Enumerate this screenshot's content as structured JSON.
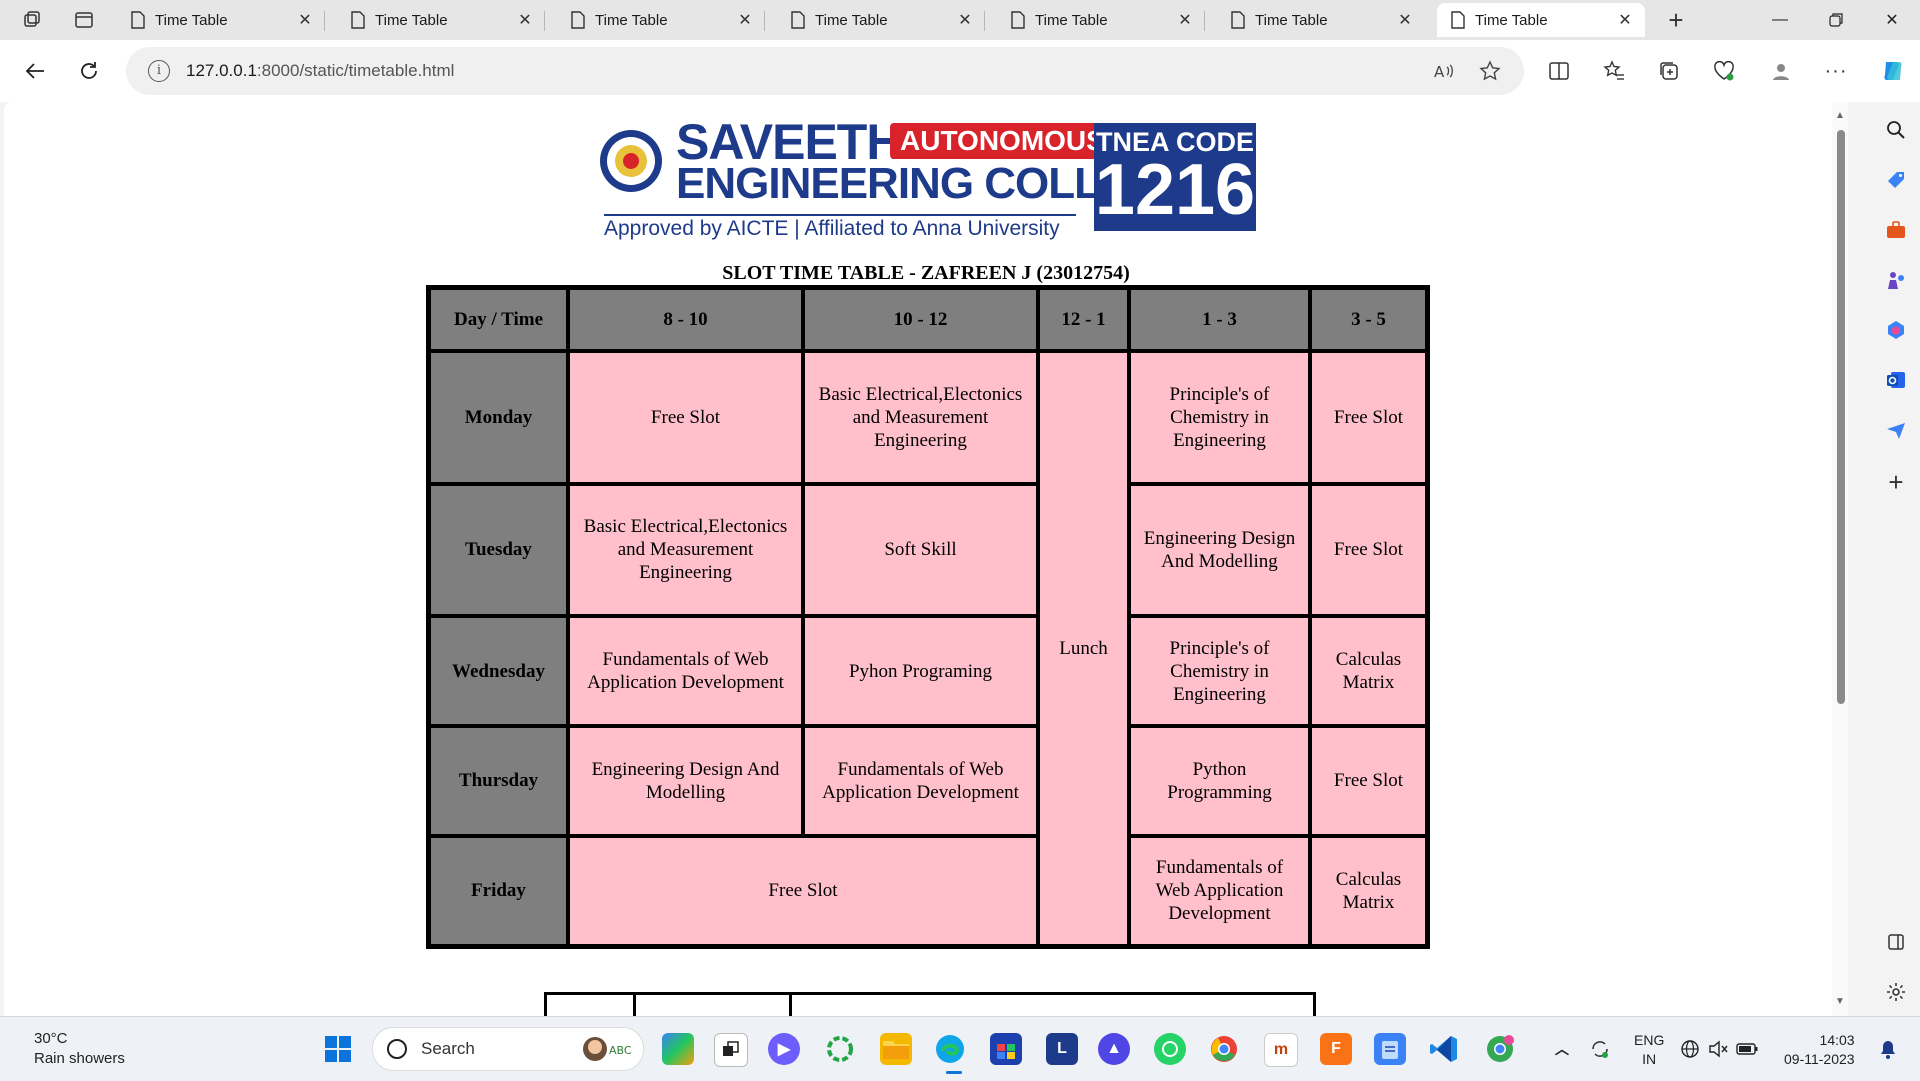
{
  "browser": {
    "tabs": [
      {
        "title": "Time Table"
      },
      {
        "title": "Time Table"
      },
      {
        "title": "Time Table"
      },
      {
        "title": "Time Table"
      },
      {
        "title": "Time Table"
      },
      {
        "title": "Time Table"
      },
      {
        "title": "Time Table",
        "active": true
      }
    ],
    "url_host": "127.0.0.1",
    "url_path": ":8000/static/timetable.html"
  },
  "logo": {
    "name_line1": "SAVEETHA",
    "badge": "AUTONOMOUS",
    "name_line2": "ENGINEERING COLLEGE",
    "affiliation": "Approved by AICTE  |  Affiliated to Anna University",
    "tnea_label": "TNEA CODE",
    "tnea_code": "1216",
    "brand_blue": "#1e3a8a",
    "brand_red": "#d8232a"
  },
  "timetable": {
    "title": "SLOT TIME TABLE - ZAFREEN J (23012754)",
    "headers": [
      "Day / Time",
      "8 - 10",
      "10 - 12",
      "12 - 1",
      "1 - 3",
      "3 - 5"
    ],
    "lunch": "Lunch",
    "rows": [
      {
        "day": "Monday",
        "s1": "Free Slot",
        "s2": "Basic Electrical,Electonics and Measurement Engineering",
        "s3": "Principle's of Chemistry in Engineering",
        "s4": "Free Slot"
      },
      {
        "day": "Tuesday",
        "s1": "Basic Electrical,Electonics and Measurement Engineering",
        "s2": "Soft Skill",
        "s3": "Engineering Design And Modelling",
        "s4": "Free Slot"
      },
      {
        "day": "Wednesday",
        "s1": "Fundamentals of Web Application Development",
        "s2": "Pyhon Programing",
        "s3": "Principle's of Chemistry in Engineering",
        "s4": "Calculas Matrix"
      },
      {
        "day": "Thursday",
        "s1": "Engineering Design And Modelling",
        "s2": "Fundamentals of Web Application Development",
        "s3": "Python Programming",
        "s4": "Free Slot"
      },
      {
        "day": "Friday",
        "s12": "Free Slot",
        "s3": "Fundamentals of Web Application Development",
        "s4": "Calculas Matrix"
      }
    ],
    "header_color": "#7f7f7f",
    "cell_color": "#ffc0cb"
  },
  "taskbar": {
    "weather_temp": "30°C",
    "weather_desc": "Rain showers",
    "search_placeholder": "Search",
    "lang_line1": "ENG",
    "lang_line2": "IN",
    "time": "14:03",
    "date": "09-11-2023"
  }
}
